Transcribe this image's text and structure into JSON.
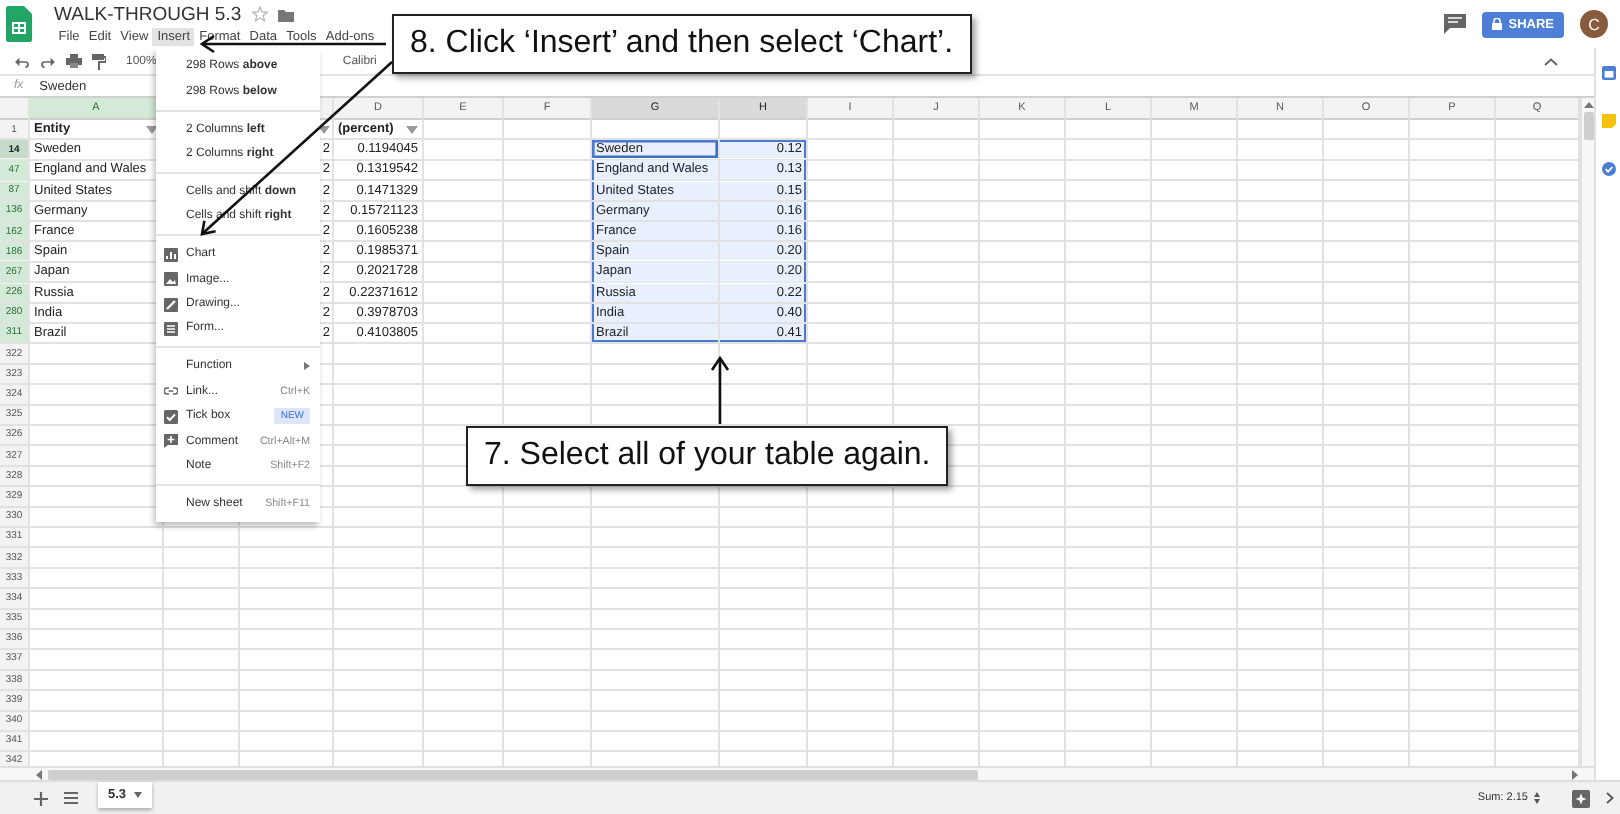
{
  "app_bar": {
    "title": "WALK-THROUGH 5.3",
    "menus": [
      {
        "label": "File",
        "selected": false
      },
      {
        "label": "Edit",
        "selected": false
      },
      {
        "label": "View",
        "selected": false
      },
      {
        "label": "Insert",
        "selected": true
      },
      {
        "label": "Format",
        "selected": false
      },
      {
        "label": "Data",
        "selected": false
      },
      {
        "label": "Tools",
        "selected": false
      },
      {
        "label": "Add-ons",
        "selected": false
      }
    ],
    "share_button": "SHARE",
    "avatar": "C"
  },
  "toolbar": {
    "zoom": "100%",
    "font": "Calibri"
  },
  "formula_bar": {
    "label": "fx",
    "value": "Sweden"
  },
  "columns": [
    {
      "label": "A",
      "filtered": true,
      "selected": false
    },
    {},
    {},
    {
      "label": "D",
      "filtered": false,
      "selected": false
    },
    {
      "label": "E",
      "filtered": false,
      "selected": false
    },
    {
      "label": "F",
      "filtered": false,
      "selected": false
    },
    {
      "label": "G",
      "filtered": false,
      "selected": true
    },
    {
      "label": "H",
      "filtered": false,
      "selected": true
    },
    {
      "label": "I",
      "filtered": false,
      "selected": false
    },
    {
      "label": "J",
      "filtered": false,
      "selected": false
    },
    {
      "label": "K",
      "filtered": false,
      "selected": false
    },
    {
      "label": "L",
      "filtered": false,
      "selected": false
    },
    {
      "label": "M",
      "filtered": false,
      "selected": false
    },
    {
      "label": "N",
      "filtered": false,
      "selected": false
    },
    {
      "label": "O",
      "filtered": false,
      "selected": false
    },
    {
      "label": "P",
      "filtered": false,
      "selected": false
    },
    {
      "label": "Q",
      "filtered": false,
      "selected": false
    }
  ],
  "rows": [
    {
      "number": "1",
      "kind": "header",
      "filtered": false,
      "selected": false,
      "active": false,
      "entity": "Entity",
      "percent": "(percent)"
    },
    {
      "number": "14",
      "kind": "data",
      "filtered": true,
      "selected": true,
      "active": true,
      "entity": "Sweden",
      "col_c": "2",
      "percent": "0.1194045",
      "copy_entity": "Sweden",
      "copy_value": "0.12"
    },
    {
      "number": "47",
      "kind": "data",
      "filtered": true,
      "selected": true,
      "active": false,
      "entity": "England and Wales",
      "col_c": "2",
      "percent": "0.1319542",
      "copy_entity": "England and Wales",
      "copy_value": "0.13"
    },
    {
      "number": "87",
      "kind": "data",
      "filtered": true,
      "selected": true,
      "active": false,
      "entity": "United States",
      "col_c": "2",
      "percent": "0.1471329",
      "copy_entity": "United States",
      "copy_value": "0.15"
    },
    {
      "number": "136",
      "kind": "data",
      "filtered": true,
      "selected": true,
      "active": false,
      "entity": "Germany",
      "col_c": "2",
      "percent": "0.15721123",
      "copy_entity": "Germany",
      "copy_value": "0.16"
    },
    {
      "number": "162",
      "kind": "data",
      "filtered": true,
      "selected": true,
      "active": false,
      "entity": "France",
      "col_c": "2",
      "percent": "0.1605238",
      "copy_entity": "France",
      "copy_value": "0.16"
    },
    {
      "number": "186",
      "kind": "data",
      "filtered": true,
      "selected": true,
      "active": false,
      "entity": "Spain",
      "col_c": "2",
      "percent": "0.1985371",
      "copy_entity": "Spain",
      "copy_value": "0.20"
    },
    {
      "number": "267",
      "kind": "data",
      "filtered": true,
      "selected": true,
      "active": false,
      "entity": "Japan",
      "col_c": "2",
      "percent": "0.2021728",
      "copy_entity": "Japan",
      "copy_value": "0.20"
    },
    {
      "number": "226",
      "kind": "data",
      "filtered": true,
      "selected": true,
      "active": false,
      "entity": "Russia",
      "col_c": "2",
      "percent": "0.22371612",
      "copy_entity": "Russia",
      "copy_value": "0.22"
    },
    {
      "number": "280",
      "kind": "data",
      "filtered": true,
      "selected": true,
      "active": false,
      "entity": "India",
      "col_c": "2",
      "percent": "0.3978703",
      "copy_entity": "India",
      "copy_value": "0.40"
    },
    {
      "number": "311",
      "kind": "data",
      "filtered": true,
      "selected": true,
      "active": false,
      "entity": "Brazil",
      "col_c": "2",
      "percent": "0.4103805",
      "copy_entity": "Brazil",
      "copy_value": "0.41"
    },
    {
      "number": "322",
      "kind": "empty",
      "filtered": false,
      "selected": false,
      "active": false
    },
    {
      "number": "323",
      "kind": "empty",
      "filtered": false,
      "selected": false,
      "active": false
    },
    {
      "number": "324",
      "kind": "empty",
      "filtered": false,
      "selected": false,
      "active": false
    },
    {
      "number": "325",
      "kind": "empty",
      "filtered": false,
      "selected": false,
      "active": false
    },
    {
      "number": "326",
      "kind": "empty",
      "filtered": false,
      "selected": false,
      "active": false
    },
    {
      "number": "327",
      "kind": "empty",
      "filtered": false,
      "selected": false,
      "active": false
    },
    {
      "number": "328",
      "kind": "empty",
      "filtered": false,
      "selected": false,
      "active": false
    },
    {
      "number": "329",
      "kind": "empty",
      "filtered": false,
      "selected": false,
      "active": false
    },
    {
      "number": "330",
      "kind": "empty",
      "filtered": false,
      "selected": false,
      "active": false
    },
    {
      "number": "331",
      "kind": "empty",
      "filtered": false,
      "selected": false,
      "active": false
    },
    {
      "number": "332",
      "kind": "empty",
      "filtered": false,
      "selected": false,
      "active": false
    },
    {
      "number": "333",
      "kind": "empty",
      "filtered": false,
      "selected": false,
      "active": false
    },
    {
      "number": "334",
      "kind": "empty",
      "filtered": false,
      "selected": false,
      "active": false
    },
    {
      "number": "335",
      "kind": "empty",
      "filtered": false,
      "selected": false,
      "active": false
    },
    {
      "number": "336",
      "kind": "empty",
      "filtered": false,
      "selected": false,
      "active": false
    },
    {
      "number": "337",
      "kind": "empty",
      "filtered": false,
      "selected": false,
      "active": false
    },
    {
      "number": "338",
      "kind": "empty",
      "filtered": false,
      "selected": false,
      "active": false
    },
    {
      "number": "339",
      "kind": "empty",
      "filtered": false,
      "selected": false,
      "active": false
    },
    {
      "number": "340",
      "kind": "empty",
      "filtered": false,
      "selected": false,
      "active": false
    },
    {
      "number": "341",
      "kind": "empty",
      "filtered": false,
      "selected": false,
      "active": false
    },
    {
      "number": "342",
      "kind": "empty",
      "filtered": false,
      "selected": false,
      "active": false
    }
  ],
  "insert_menu": {
    "items": [
      {
        "kind": "text",
        "label": "298 Rows **above**"
      },
      {
        "kind": "text",
        "label": "298 Rows **below**"
      },
      {
        "kind": "divider"
      },
      {
        "kind": "text",
        "label": "2 Columns **left**"
      },
      {
        "kind": "text",
        "label": "2 Columns **right**"
      },
      {
        "kind": "divider"
      },
      {
        "kind": "text",
        "label": "Cells and shift **down**"
      },
      {
        "kind": "text",
        "label": "Cells and shift **right**"
      },
      {
        "kind": "divider"
      },
      {
        "kind": "chart",
        "label": "Chart"
      },
      {
        "kind": "image",
        "label": "Image..."
      },
      {
        "kind": "drawing",
        "label": "Drawing..."
      },
      {
        "kind": "form",
        "label": "Form..."
      },
      {
        "kind": "divider"
      },
      {
        "kind": "submenu",
        "label": "Function"
      },
      {
        "kind": "link",
        "label": "Link...",
        "shortcut": "Ctrl+K"
      },
      {
        "kind": "tickbox",
        "label": "Tick box",
        "badge": "NEW"
      },
      {
        "kind": "comment",
        "label": "Comment",
        "shortcut": "Ctrl+Alt+M"
      },
      {
        "kind": "text",
        "label": "Note",
        "shortcut": "Shift+F2"
      },
      {
        "kind": "divider"
      },
      {
        "kind": "text",
        "label": "New sheet",
        "shortcut": "Shift+F11"
      }
    ]
  },
  "callouts": [
    {
      "text": "8. Click ‘Insert’ and then select ‘Chart’."
    },
    {
      "text": "7. Select all of your table again."
    }
  ],
  "sheet_tabs": [
    {
      "label": "5.3",
      "selected": true
    }
  ],
  "status": {
    "sum": "Sum: 2.15"
  }
}
